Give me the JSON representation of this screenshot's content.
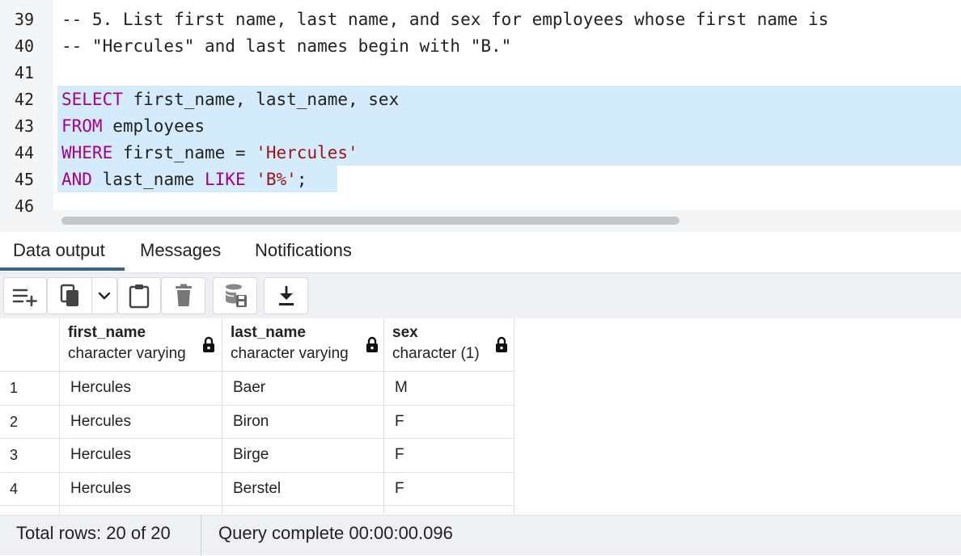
{
  "editor": {
    "lines": [
      {
        "num": "39",
        "comment": "-- 5. List first name, last name, and sex for employees whose first name is"
      },
      {
        "num": "40",
        "comment": "-- \"Hercules\" and last names begin with \"B.\""
      },
      {
        "num": "41"
      },
      {
        "num": "42",
        "kw": "SELECT",
        "rest": " first_name, last_name, sex"
      },
      {
        "num": "43",
        "kw": "FROM",
        "rest": " employees"
      },
      {
        "num": "44",
        "kw": "WHERE",
        "rest": " first_name = ",
        "str": "'Hercules'"
      },
      {
        "num": "45",
        "kw": "AND",
        "rest": " last_name ",
        "kw2": "LIKE",
        "str": "'B%'",
        "end": ";"
      },
      {
        "num": "46"
      }
    ]
  },
  "tabs": [
    "Data output",
    "Messages",
    "Notifications"
  ],
  "toolbar": {
    "icons": [
      "add-row-icon",
      "copy-icon",
      "chevron-down-icon",
      "paste-icon",
      "delete-icon",
      "save-data-icon",
      "download-icon"
    ]
  },
  "grid": {
    "columns": [
      {
        "name": "first_name",
        "type": "character varying"
      },
      {
        "name": "last_name",
        "type": "character varying"
      },
      {
        "name": "sex",
        "type": "character (1)"
      }
    ],
    "rows": [
      {
        "n": "1",
        "cells": [
          "Hercules",
          "Baer",
          "M"
        ]
      },
      {
        "n": "2",
        "cells": [
          "Hercules",
          "Biron",
          "F"
        ]
      },
      {
        "n": "3",
        "cells": [
          "Hercules",
          "Birge",
          "F"
        ]
      },
      {
        "n": "4",
        "cells": [
          "Hercules",
          "Berstel",
          "F"
        ]
      }
    ]
  },
  "status": {
    "total_rows": "Total rows: 20 of 20",
    "query": "Query complete 00:00:00.096"
  },
  "colors": {
    "keyword": "#a3008c",
    "comment": "#b36a00",
    "string": "#a11212",
    "selection": "#d3ebfa",
    "active_tab": "#326690"
  }
}
